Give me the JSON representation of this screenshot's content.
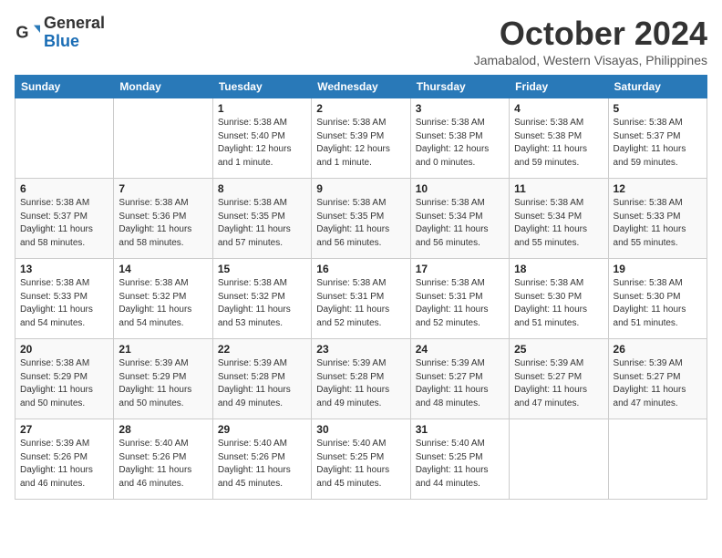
{
  "header": {
    "logo": {
      "general": "General",
      "blue": "Blue"
    },
    "month": "October 2024",
    "location": "Jamabalod, Western Visayas, Philippines"
  },
  "weekdays": [
    "Sunday",
    "Monday",
    "Tuesday",
    "Wednesday",
    "Thursday",
    "Friday",
    "Saturday"
  ],
  "weeks": [
    [
      null,
      null,
      {
        "day": "1",
        "sunrise": "Sunrise: 5:38 AM",
        "sunset": "Sunset: 5:40 PM",
        "daylight": "Daylight: 12 hours and 1 minute."
      },
      {
        "day": "2",
        "sunrise": "Sunrise: 5:38 AM",
        "sunset": "Sunset: 5:39 PM",
        "daylight": "Daylight: 12 hours and 1 minute."
      },
      {
        "day": "3",
        "sunrise": "Sunrise: 5:38 AM",
        "sunset": "Sunset: 5:38 PM",
        "daylight": "Daylight: 12 hours and 0 minutes."
      },
      {
        "day": "4",
        "sunrise": "Sunrise: 5:38 AM",
        "sunset": "Sunset: 5:38 PM",
        "daylight": "Daylight: 11 hours and 59 minutes."
      },
      {
        "day": "5",
        "sunrise": "Sunrise: 5:38 AM",
        "sunset": "Sunset: 5:37 PM",
        "daylight": "Daylight: 11 hours and 59 minutes."
      }
    ],
    [
      {
        "day": "6",
        "sunrise": "Sunrise: 5:38 AM",
        "sunset": "Sunset: 5:37 PM",
        "daylight": "Daylight: 11 hours and 58 minutes."
      },
      {
        "day": "7",
        "sunrise": "Sunrise: 5:38 AM",
        "sunset": "Sunset: 5:36 PM",
        "daylight": "Daylight: 11 hours and 58 minutes."
      },
      {
        "day": "8",
        "sunrise": "Sunrise: 5:38 AM",
        "sunset": "Sunset: 5:35 PM",
        "daylight": "Daylight: 11 hours and 57 minutes."
      },
      {
        "day": "9",
        "sunrise": "Sunrise: 5:38 AM",
        "sunset": "Sunset: 5:35 PM",
        "daylight": "Daylight: 11 hours and 56 minutes."
      },
      {
        "day": "10",
        "sunrise": "Sunrise: 5:38 AM",
        "sunset": "Sunset: 5:34 PM",
        "daylight": "Daylight: 11 hours and 56 minutes."
      },
      {
        "day": "11",
        "sunrise": "Sunrise: 5:38 AM",
        "sunset": "Sunset: 5:34 PM",
        "daylight": "Daylight: 11 hours and 55 minutes."
      },
      {
        "day": "12",
        "sunrise": "Sunrise: 5:38 AM",
        "sunset": "Sunset: 5:33 PM",
        "daylight": "Daylight: 11 hours and 55 minutes."
      }
    ],
    [
      {
        "day": "13",
        "sunrise": "Sunrise: 5:38 AM",
        "sunset": "Sunset: 5:33 PM",
        "daylight": "Daylight: 11 hours and 54 minutes."
      },
      {
        "day": "14",
        "sunrise": "Sunrise: 5:38 AM",
        "sunset": "Sunset: 5:32 PM",
        "daylight": "Daylight: 11 hours and 54 minutes."
      },
      {
        "day": "15",
        "sunrise": "Sunrise: 5:38 AM",
        "sunset": "Sunset: 5:32 PM",
        "daylight": "Daylight: 11 hours and 53 minutes."
      },
      {
        "day": "16",
        "sunrise": "Sunrise: 5:38 AM",
        "sunset": "Sunset: 5:31 PM",
        "daylight": "Daylight: 11 hours and 52 minutes."
      },
      {
        "day": "17",
        "sunrise": "Sunrise: 5:38 AM",
        "sunset": "Sunset: 5:31 PM",
        "daylight": "Daylight: 11 hours and 52 minutes."
      },
      {
        "day": "18",
        "sunrise": "Sunrise: 5:38 AM",
        "sunset": "Sunset: 5:30 PM",
        "daylight": "Daylight: 11 hours and 51 minutes."
      },
      {
        "day": "19",
        "sunrise": "Sunrise: 5:38 AM",
        "sunset": "Sunset: 5:30 PM",
        "daylight": "Daylight: 11 hours and 51 minutes."
      }
    ],
    [
      {
        "day": "20",
        "sunrise": "Sunrise: 5:38 AM",
        "sunset": "Sunset: 5:29 PM",
        "daylight": "Daylight: 11 hours and 50 minutes."
      },
      {
        "day": "21",
        "sunrise": "Sunrise: 5:39 AM",
        "sunset": "Sunset: 5:29 PM",
        "daylight": "Daylight: 11 hours and 50 minutes."
      },
      {
        "day": "22",
        "sunrise": "Sunrise: 5:39 AM",
        "sunset": "Sunset: 5:28 PM",
        "daylight": "Daylight: 11 hours and 49 minutes."
      },
      {
        "day": "23",
        "sunrise": "Sunrise: 5:39 AM",
        "sunset": "Sunset: 5:28 PM",
        "daylight": "Daylight: 11 hours and 49 minutes."
      },
      {
        "day": "24",
        "sunrise": "Sunrise: 5:39 AM",
        "sunset": "Sunset: 5:27 PM",
        "daylight": "Daylight: 11 hours and 48 minutes."
      },
      {
        "day": "25",
        "sunrise": "Sunrise: 5:39 AM",
        "sunset": "Sunset: 5:27 PM",
        "daylight": "Daylight: 11 hours and 47 minutes."
      },
      {
        "day": "26",
        "sunrise": "Sunrise: 5:39 AM",
        "sunset": "Sunset: 5:27 PM",
        "daylight": "Daylight: 11 hours and 47 minutes."
      }
    ],
    [
      {
        "day": "27",
        "sunrise": "Sunrise: 5:39 AM",
        "sunset": "Sunset: 5:26 PM",
        "daylight": "Daylight: 11 hours and 46 minutes."
      },
      {
        "day": "28",
        "sunrise": "Sunrise: 5:40 AM",
        "sunset": "Sunset: 5:26 PM",
        "daylight": "Daylight: 11 hours and 46 minutes."
      },
      {
        "day": "29",
        "sunrise": "Sunrise: 5:40 AM",
        "sunset": "Sunset: 5:26 PM",
        "daylight": "Daylight: 11 hours and 45 minutes."
      },
      {
        "day": "30",
        "sunrise": "Sunrise: 5:40 AM",
        "sunset": "Sunset: 5:25 PM",
        "daylight": "Daylight: 11 hours and 45 minutes."
      },
      {
        "day": "31",
        "sunrise": "Sunrise: 5:40 AM",
        "sunset": "Sunset: 5:25 PM",
        "daylight": "Daylight: 11 hours and 44 minutes."
      },
      null,
      null
    ]
  ]
}
